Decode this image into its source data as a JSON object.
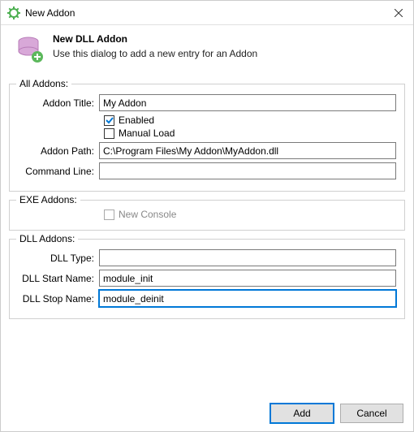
{
  "window": {
    "title": "New Addon"
  },
  "header": {
    "title": "New DLL Addon",
    "subtitle": "Use this dialog to add a new entry for an Addon"
  },
  "group_all": {
    "legend": "All Addons:",
    "addon_title_label": "Addon Title:",
    "addon_title_value": "My Addon",
    "enabled_label": "Enabled",
    "enabled_checked": true,
    "manual_load_label": "Manual Load",
    "manual_load_checked": false,
    "addon_path_label": "Addon Path:",
    "addon_path_value": "C:\\Program Files\\My Addon\\MyAddon.dll",
    "command_line_label": "Command Line:",
    "command_line_value": ""
  },
  "group_exe": {
    "legend": "EXE Addons:",
    "new_console_label": "New Console",
    "new_console_checked": false,
    "disabled": true
  },
  "group_dll": {
    "legend": "DLL Addons:",
    "dll_type_label": "DLL Type:",
    "dll_type_value": "",
    "dll_start_label": "DLL Start Name:",
    "dll_start_value": "module_init",
    "dll_stop_label": "DLL Stop Name:",
    "dll_stop_value": "module_deinit"
  },
  "buttons": {
    "add": "Add",
    "cancel": "Cancel"
  }
}
